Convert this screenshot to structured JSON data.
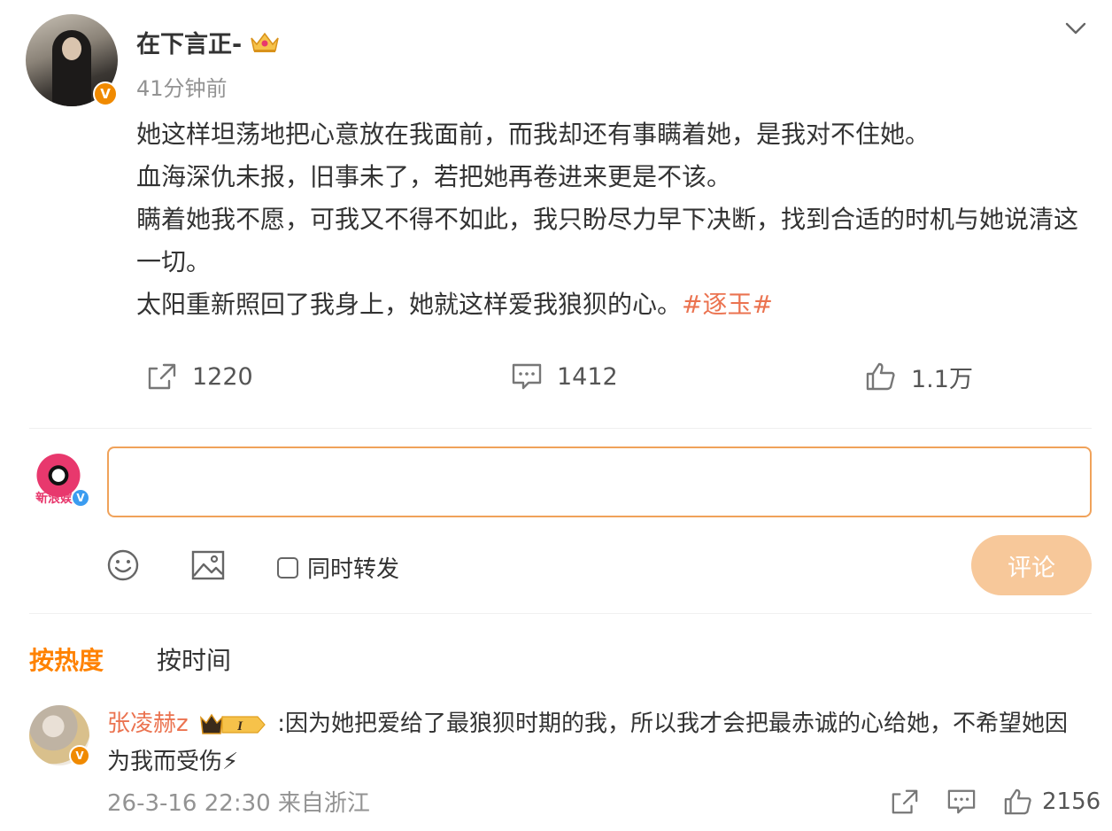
{
  "post": {
    "username": "在下言正-",
    "timestamp": "41分钟前",
    "lines": [
      "她这样坦荡地把心意放在我面前，而我却还有事瞒着她，是我对不住她。",
      "血海深仇未报，旧事未了，若把她再卷进来更是不该。",
      "瞒着她我不愿，可我又不得不如此，我只盼尽力早下决断，找到合适的时机与她说清这一切。",
      "太阳重新照回了我身上，她就这样爱我狼狈的心。"
    ],
    "hashtag": "#逐玉#",
    "repost_count": "1220",
    "comment_count": "1412",
    "like_count": "1.1万"
  },
  "composer": {
    "avatar_text": "新浪娱",
    "input_value": "",
    "repost_label": "同时转发",
    "submit_label": "评论"
  },
  "sort": {
    "hot_label": "按热度",
    "time_label": "按时间"
  },
  "comment": {
    "username": "张凌赫z",
    "level_badge": "I",
    "text": ":因为她把爱给了最狼狈时期的我，所以我才会把最赤诚的心给她，不希望她因为我而受伤⚡",
    "meta": "26-3-16 22:30 来自浙江",
    "like_count": "2156"
  },
  "colors": {
    "accent_orange": "#ff8200",
    "hashtag": "#eb7350",
    "input_border": "#f0a25a",
    "submit_bg": "#f7c89a",
    "verified_orange": "#f08a00",
    "verified_blue": "#3b9cf0"
  },
  "icons": [
    "chevron-down-icon",
    "repost-icon",
    "comment-icon",
    "like-icon",
    "emoji-icon",
    "image-icon",
    "crown-icon"
  ]
}
